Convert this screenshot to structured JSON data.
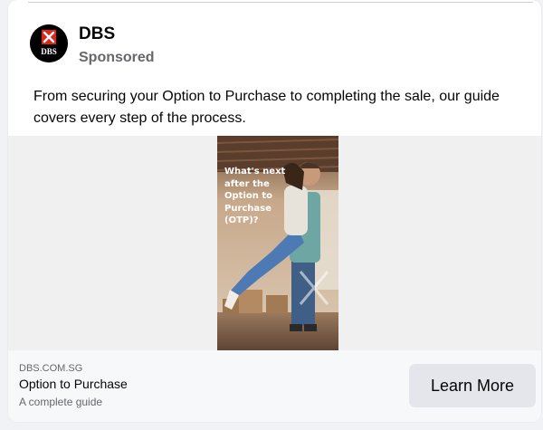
{
  "ad": {
    "page_name": "DBS",
    "sponsored_label": "Sponsored",
    "logo_text": "DBS",
    "body_text": "From securing your Option to Purchase to completing the sale, our guide covers every step of the process.",
    "creative_overlay_text": "What's next\nafter the\nOption to\nPurchase\n(OTP)?",
    "link": {
      "domain": "DBS.COM.SG",
      "headline": "Option to Purchase",
      "description": "A complete guide"
    },
    "cta_label": "Learn More"
  },
  "colors": {
    "brand_red": "#e1251b",
    "text_primary": "#050505",
    "text_secondary": "#65676b",
    "cta_background": "#e4e6eb"
  }
}
